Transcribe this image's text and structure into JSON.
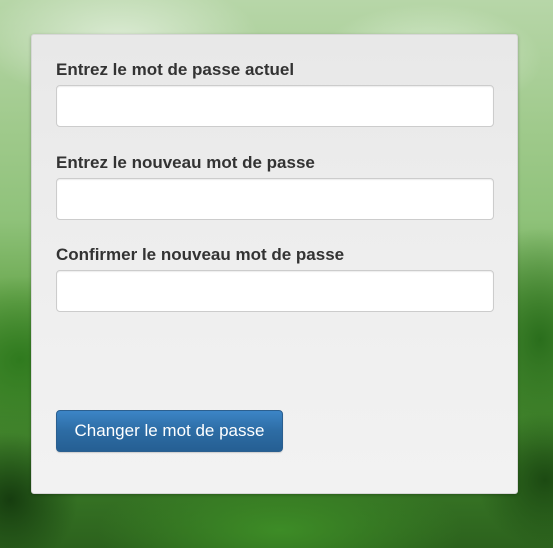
{
  "form": {
    "current_password": {
      "label": "Entrez le mot de passe actuel",
      "value": ""
    },
    "new_password": {
      "label": "Entrez le nouveau mot de passe",
      "value": ""
    },
    "confirm_password": {
      "label": "Confirmer le nouveau mot de passe",
      "value": ""
    },
    "submit_label": "Changer le mot de passe"
  },
  "colors": {
    "panel_background": "#eeeeee",
    "label_text": "#333333",
    "button_primary": "#2d6ca4",
    "button_text": "#ffffff"
  }
}
